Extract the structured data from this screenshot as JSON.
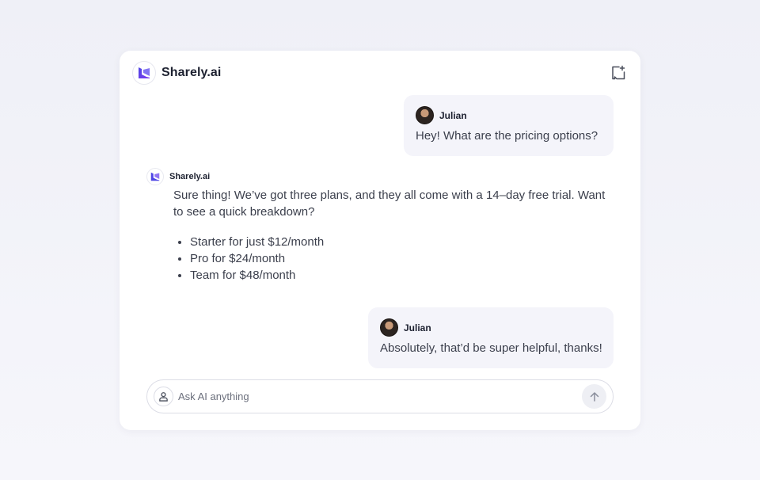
{
  "header": {
    "brand_name": "Sharely.ai",
    "logo_icon": "sharely-logo-icon",
    "new_chat_icon": "new-chat-icon",
    "accent_colors": [
      "#4f46e5",
      "#7c3aed"
    ]
  },
  "messages": [
    {
      "role": "user",
      "sender": "Julian",
      "text": "Hey! What are the pricing options?"
    },
    {
      "role": "assistant",
      "sender": "Sharely.ai",
      "text": "Sure thing! We’ve got three plans, and they all come with a 14–day free trial. Want to see a quick breakdown?",
      "list": [
        "Starter for just $12/month",
        "Pro for $24/month",
        "Team for $48/month"
      ]
    },
    {
      "role": "user",
      "sender": "Julian",
      "text": "Absolutely, that’d be super helpful, thanks!"
    }
  ],
  "composer": {
    "placeholder": "Ask AI anything",
    "value": "",
    "user_icon": "user-icon",
    "send_icon": "arrow-up-icon"
  }
}
